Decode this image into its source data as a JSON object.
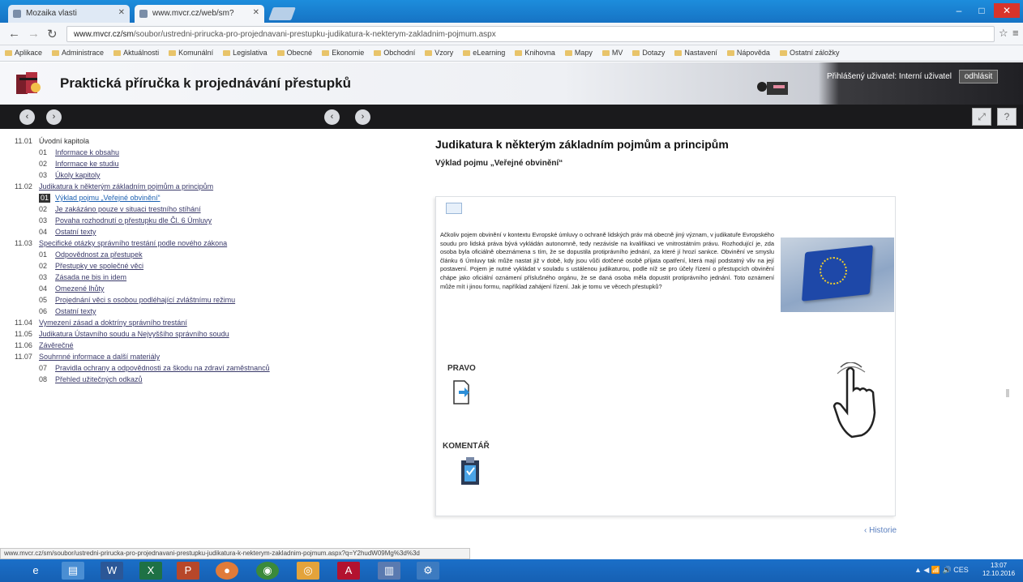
{
  "browser": {
    "tabs": [
      {
        "label": "Mozaika vlasti"
      },
      {
        "label": "www.mvcr.cz/web/sm?"
      }
    ],
    "window_controls": {
      "minimize": "–",
      "maximize": "□",
      "close": "✕"
    },
    "nav": {
      "back": "←",
      "forward": "→",
      "reload": "↻"
    },
    "url": {
      "host": "www.mvcr.cz/sm",
      "path": "/soubor/ustredni-prirucka-pro-projednavani-prestupku-judikatura-k-nekterym-zakladnim-pojmum.aspx"
    },
    "star": "☆",
    "menu": "≡",
    "bookmarks": [
      "Aplikace",
      "Administrace",
      "Aktuálnosti",
      "Komunální",
      "Legislativa",
      "Obecné",
      "Ekonomie",
      "Obchodní",
      "Vzory",
      "eLearning",
      "Knihovna",
      "Mapy",
      "MV",
      "Dotazy",
      "Nastavení",
      "Nápověda",
      "Ostatní záložky"
    ]
  },
  "app": {
    "title": "Praktická příručka k projednávání přestupků",
    "user_text": "Přihlášený uživatel: Interní uživatel",
    "logout": "odhlásit",
    "toolbar_buttons": {
      "prev": "‹",
      "next": "›",
      "prev2": "‹",
      "next2": "›",
      "expand": "⤢",
      "help": "?"
    }
  },
  "toc": [
    {
      "num": "11.01",
      "label": "Úvodní kapitola",
      "level": 1,
      "plain": true
    },
    {
      "num": "01",
      "label": "Informace k obsahu",
      "level": 2
    },
    {
      "num": "02",
      "label": "Informace ke studiu",
      "level": 2
    },
    {
      "num": "03",
      "label": "Úkoly kapitoly",
      "level": 2
    },
    {
      "num": "11.02",
      "label": "Judikatura k některým základním pojmům a principům",
      "level": 1
    },
    {
      "num": "01",
      "label": "Výklad pojmu „Veřejné obvinění“",
      "level": 2,
      "selected": true
    },
    {
      "num": "02",
      "label": "Je zakázáno pouze v situaci trestního stíhání",
      "level": 2
    },
    {
      "num": "03",
      "label": "Povaha rozhodnutí o přestupku dle Čl. 6 Úmluvy",
      "level": 2
    },
    {
      "num": "04",
      "label": "Ostatní texty",
      "level": 2
    },
    {
      "num": "11.03",
      "label": "Specifické otázky správního trestání podle nového zákona",
      "level": 1
    },
    {
      "num": "01",
      "label": "Odpovědnost za přestupek",
      "level": 2
    },
    {
      "num": "02",
      "label": "Přestupky ve společné věci",
      "level": 2
    },
    {
      "num": "03",
      "label": "Zásada ne bis in idem",
      "level": 2
    },
    {
      "num": "04",
      "label": "Omezené lhůty",
      "level": 2
    },
    {
      "num": "05",
      "label": "Projednání věci s osobou podléhající zvláštnímu režimu",
      "level": 2,
      "wrap": true
    },
    {
      "num": "06",
      "label": "Ostatní texty",
      "level": 2
    },
    {
      "num": "11.04",
      "label": "Vymezení zásad a doktríny správního trestání",
      "level": 1
    },
    {
      "num": "11.05",
      "label": "Judikatura Ústavního soudu a Nejvyššího správního soudu",
      "level": 1
    },
    {
      "num": "11.06",
      "label": "Závěrečné",
      "level": 1
    },
    {
      "num": "11.07",
      "label": "Souhrnné informace a další materiály",
      "level": 1
    },
    {
      "num": "07",
      "label": "Pravidla ochrany a odpovědnosti za škodu na zdraví zaměstnanců",
      "level": 2,
      "wrap": true
    },
    {
      "num": "08",
      "label": "Přehled užitečných odkazů",
      "level": 2
    }
  ],
  "content": {
    "title": "Judikatura k některým základním pojmům a principům",
    "subtitle": "Výklad pojmu „Veřejné obvinění“",
    "body": "Ačkoliv pojem obvinění v kontextu Evropské úmluvy o ochraně lidských práv má obecně jiný význam, v judikatuře Evropského soudu pro lidská práva bývá vykládán autonomně, tedy nezávisle na kvalifikaci ve vnitrostátním právu. Rozhodující je, zda osoba byla oficiálně obeznámena s tím, že se dopustila protiprávního jednání, za které jí hrozí sankce. Obvinění ve smyslu článku 6 Úmluvy tak může nastat již v době, kdy jsou vůči dotčené osobě přijata opatření, která mají podstatný vliv na její postavení. Pojem je nutné vykládat v souladu s ustálenou judikaturou, podle níž se pro účely řízení o přestupcích obvinění chápe jako oficiální oznámení příslušného orgánu, že se daná osoba měla dopustit protiprávního jednání. Toto oznámení může mít i jinou formu, například zahájení řízení. Jak je tomu ve věcech přestupků?",
    "pravo_label": "PRAVO",
    "komentar_label": "KOMENTÁŘ",
    "back_link": "‹ Historie"
  },
  "status_url": "www.mvcr.cz/sm/soubor/ustredni-prirucka-pro-projednavani-prestupku-judikatura-k-nekterym-zakladnim-pojmum.aspx?q=Y2hudW09Mg%3d%3d",
  "taskbar": {
    "tray": "▲ ◀ 📶 🔊 CES",
    "time": "13:07",
    "date": "12.10.2016"
  },
  "colors": {
    "accent": "#1673c4",
    "toolbar": "#1a1a1c",
    "link": "#3a3a6a"
  }
}
